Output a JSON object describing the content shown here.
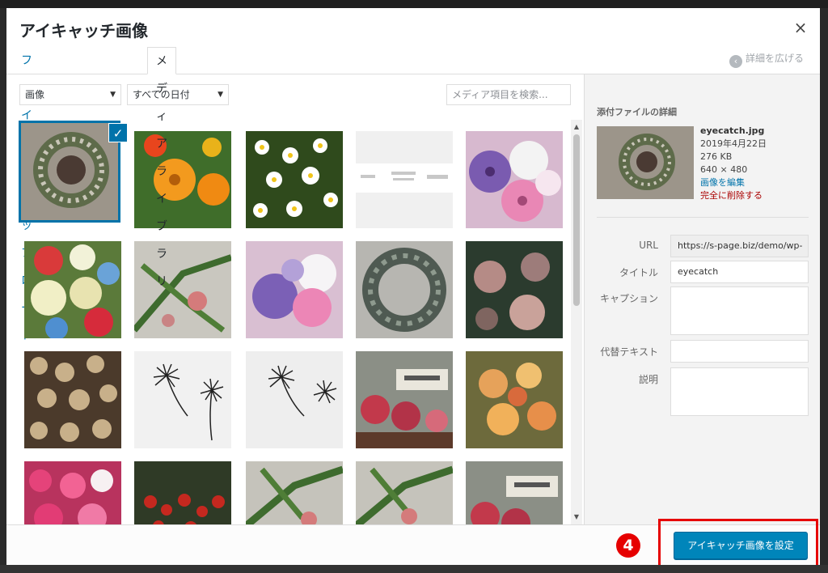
{
  "modal": {
    "title": "アイキャッチ画像",
    "close_icon": "×"
  },
  "tabs": [
    {
      "label": "ファイルをアップロード",
      "active": false
    },
    {
      "label": "メディアライブラリ",
      "active": true
    }
  ],
  "expand_details": {
    "icon": "‹",
    "label": "詳細を広げる"
  },
  "toolbar": {
    "type_filter": "画像",
    "date_filter": "すべての日付",
    "search_placeholder": "メディア項目を検索..."
  },
  "selected_check_icon": "✓",
  "attachment": {
    "heading": "添付ファイルの詳細",
    "filename": "eyecatch.jpg",
    "date": "2019年4月22日",
    "size": "276 KB",
    "dimensions": "640 × 480",
    "edit_link": "画像を編集",
    "delete_link": "完全に削除する",
    "fields": {
      "url_label": "URL",
      "url_value": "https://s-page.biz/demo/wp-",
      "title_label": "タイトル",
      "title_value": "eyecatch",
      "caption_label": "キャプション",
      "alt_label": "代替テキスト",
      "description_label": "説明"
    }
  },
  "footer": {
    "step_number": "4",
    "set_button": "アイキャッチ画像を設定"
  }
}
